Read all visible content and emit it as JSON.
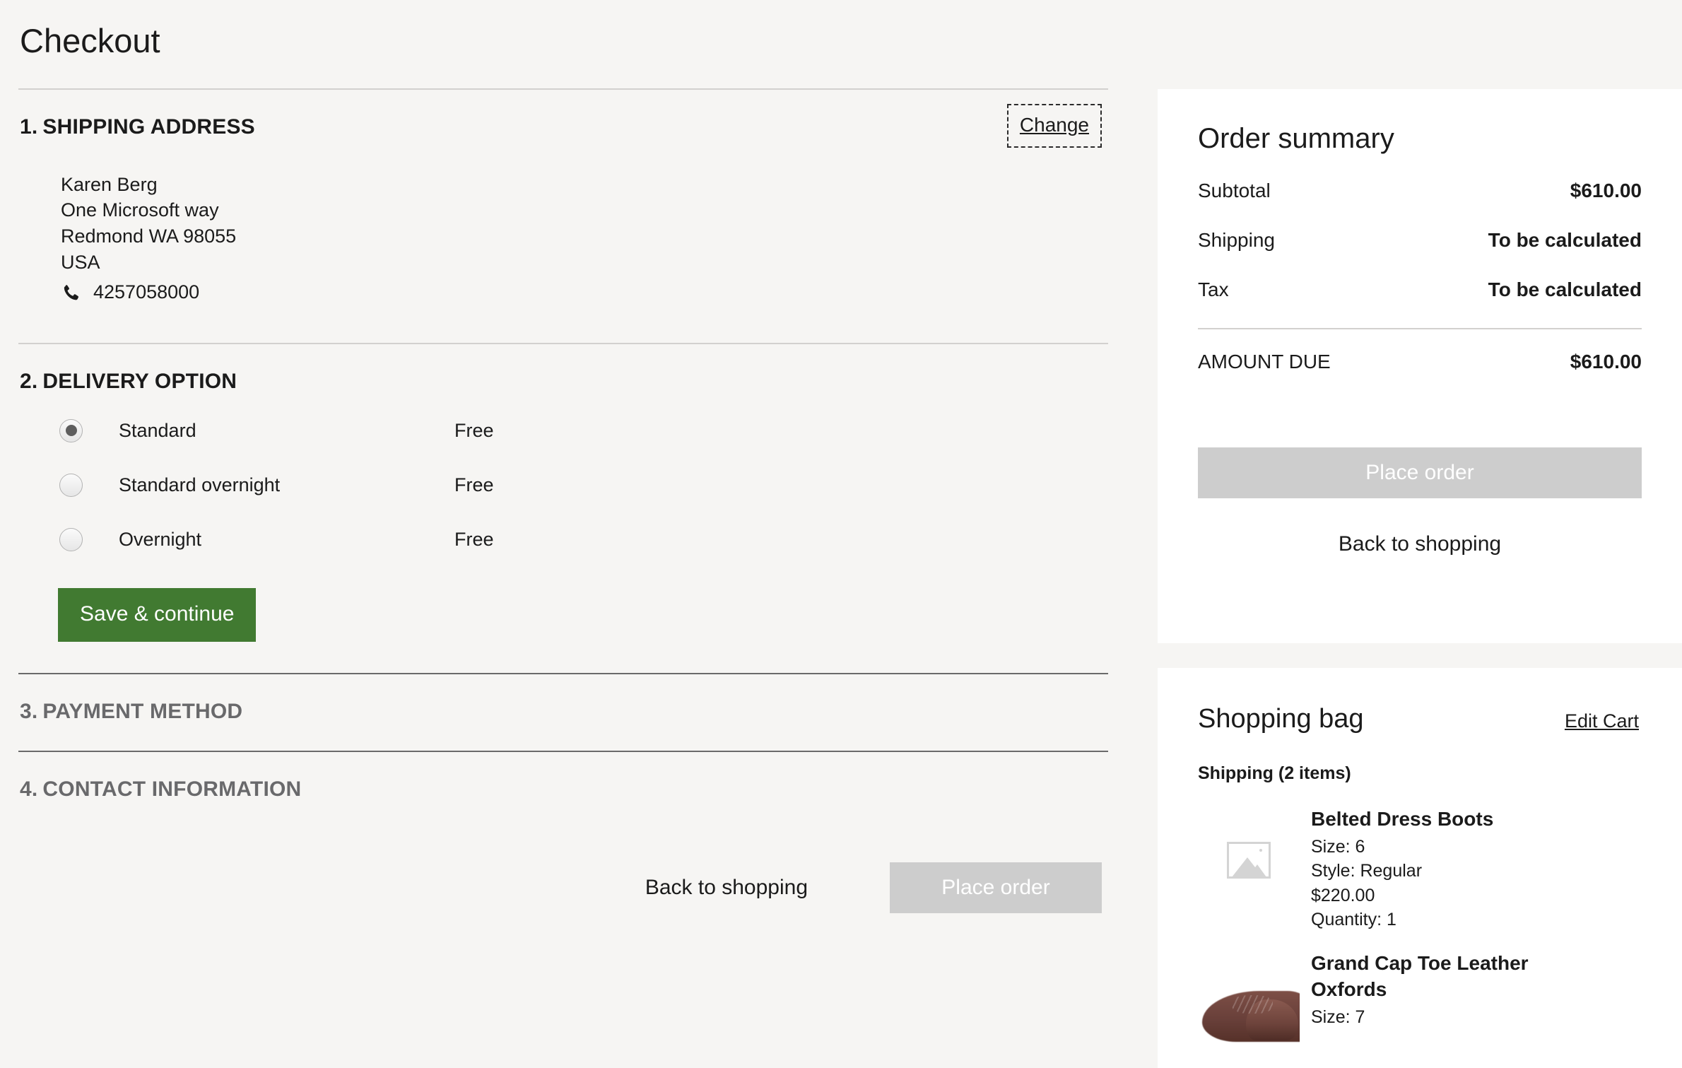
{
  "page": {
    "title": "Checkout"
  },
  "sections": {
    "shipping": {
      "number": "1.",
      "title": "SHIPPING ADDRESS",
      "change_label": "Change",
      "address": {
        "name": "Karen Berg",
        "street": "One Microsoft way",
        "city_state_zip": "Redmond WA  98055",
        "country": "USA",
        "phone": "4257058000",
        "phone_icon": "phone-icon"
      }
    },
    "delivery": {
      "number": "2.",
      "title": "DELIVERY OPTION",
      "options": [
        {
          "label": "Standard",
          "price": "Free",
          "selected": true
        },
        {
          "label": "Standard overnight",
          "price": "Free",
          "selected": false
        },
        {
          "label": "Overnight",
          "price": "Free",
          "selected": false
        }
      ],
      "save_label": "Save & continue"
    },
    "payment": {
      "number": "3.",
      "title": "PAYMENT METHOD"
    },
    "contact": {
      "number": "4.",
      "title": "CONTACT INFORMATION"
    }
  },
  "bottom_actions": {
    "back_label": "Back to shopping",
    "place_order_label": "Place order"
  },
  "order_summary": {
    "title": "Order summary",
    "rows": [
      {
        "label": "Subtotal",
        "value": "$610.00"
      },
      {
        "label": "Shipping",
        "value": "To be calculated"
      },
      {
        "label": "Tax",
        "value": "To be calculated"
      }
    ],
    "total": {
      "label": "AMOUNT DUE",
      "value": "$610.00"
    },
    "place_order_label": "Place order",
    "back_label": "Back to shopping"
  },
  "shopping_bag": {
    "title": "Shopping bag",
    "edit_label": "Edit Cart",
    "shipping_group": "Shipping (2 items)",
    "items": [
      {
        "name": "Belted Dress Boots",
        "size": "Size: 6",
        "style": "Style: Regular",
        "price": "$220.00",
        "quantity": "Quantity: 1",
        "image": "image-placeholder-icon"
      },
      {
        "name": "Grand Cap Toe Leather Oxfords",
        "size": "Size: 7",
        "image": "brown-oxford-shoe-photo"
      }
    ]
  },
  "colors": {
    "page_background": "#f6f5f3",
    "card_background": "#ffffff",
    "primary_button": "#417a31",
    "disabled_button": "#cdcdcd",
    "text": "#1b1b1b",
    "muted_text": "#69696b",
    "rule": "#d2d0ce"
  }
}
